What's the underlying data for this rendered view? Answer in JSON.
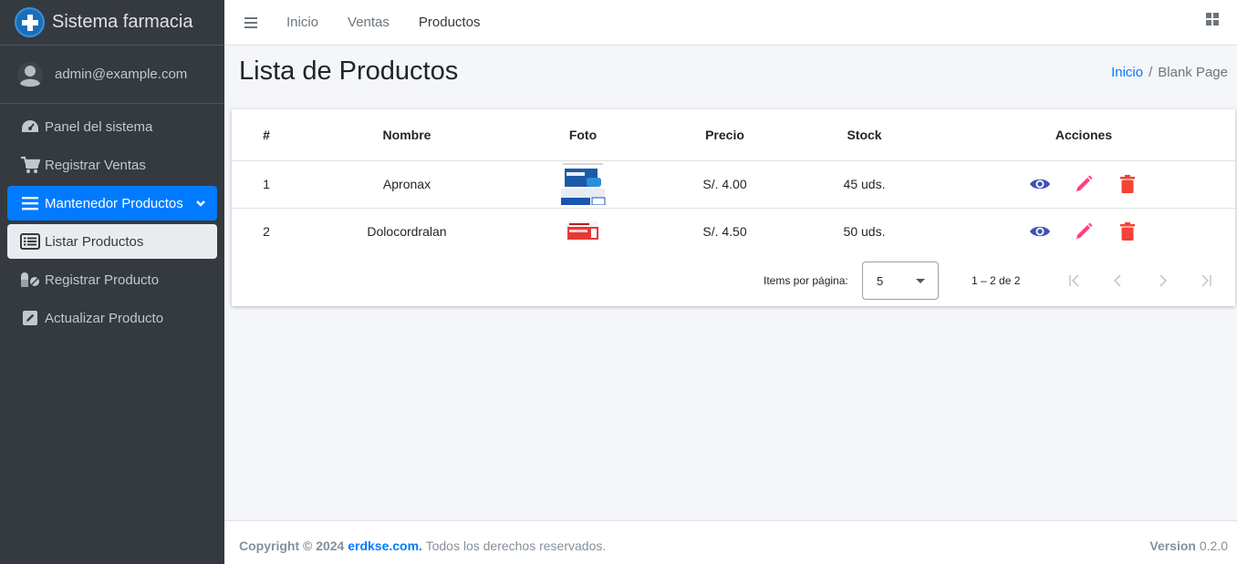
{
  "brand": {
    "name": "Sistema farmacia",
    "logo_icon": "plus-circle-icon"
  },
  "user": {
    "email": "admin@example.com",
    "avatar_icon": "user-avatar-icon"
  },
  "sidebar": {
    "items": [
      {
        "label": "Panel del sistema",
        "icon": "dashboard-gauge-icon"
      },
      {
        "label": "Registrar Ventas",
        "icon": "cart-icon"
      },
      {
        "label": "Mantenedor Productos",
        "icon": "menu-lines-icon"
      },
      {
        "label": "Listar Productos",
        "icon": "list-alt-icon"
      },
      {
        "label": "Registrar Producto",
        "icon": "pills-icon"
      },
      {
        "label": "Actualizar Producto",
        "icon": "edit-square-icon"
      }
    ]
  },
  "topbar": {
    "links": [
      "Inicio",
      "Ventas",
      "Productos"
    ],
    "menu_icon": "hamburger-icon",
    "apps_icon": "grid-icon"
  },
  "page": {
    "title": "Lista de Productos"
  },
  "breadcrumb": {
    "home": "Inicio",
    "separator": "/",
    "current": "Blank Page"
  },
  "table": {
    "headers": [
      "#",
      "Nombre",
      "Foto",
      "Precio",
      "Stock",
      "Acciones"
    ],
    "rows": [
      {
        "id": "1",
        "name": "Apronax",
        "price": "S/. 4.00",
        "stock": "45 uds."
      },
      {
        "id": "2",
        "name": "Dolocordralan",
        "price": "S/. 4.50",
        "stock": "50 uds."
      }
    ],
    "action_colors": {
      "view": "#3f51b5",
      "edit": "#ff4081",
      "delete": "#f44336"
    }
  },
  "paginator": {
    "label": "Items por página:",
    "page_size": "5",
    "range": "1 – 2 de 2"
  },
  "footer": {
    "copyright": "Copyright © 2024",
    "site": "erdkse.com.",
    "rights": "Todos los derechos reservados.",
    "version_label": "Version",
    "version": "0.2.0"
  }
}
